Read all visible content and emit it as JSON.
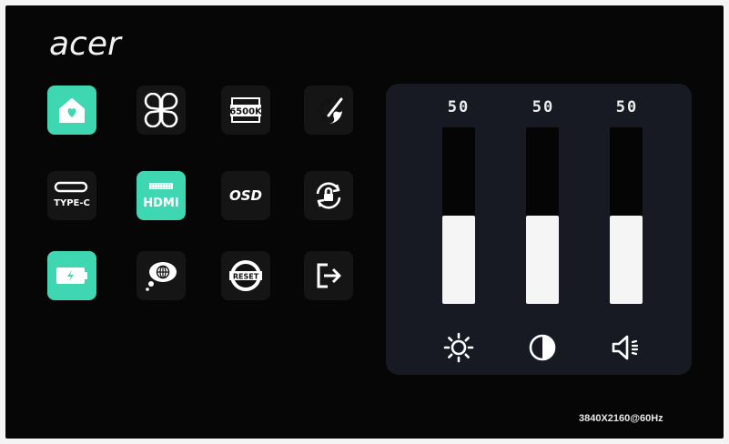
{
  "brand": {
    "logo_text": "acer"
  },
  "menu": {
    "items": [
      {
        "icon": "home-icon",
        "active": true
      },
      {
        "icon": "mode-grid-icon",
        "active": false
      },
      {
        "icon": "color-temperature-icon",
        "label": "6500K",
        "active": false
      },
      {
        "icon": "color-palette-icon",
        "active": false
      },
      {
        "icon": "type-c-icon",
        "label": "TYPE-C",
        "active": false
      },
      {
        "icon": "hdmi-icon",
        "label": "HDMI",
        "active": true
      },
      {
        "icon": "osd-icon",
        "label": "OSD",
        "active": false
      },
      {
        "icon": "lock-rotate-icon",
        "active": false
      },
      {
        "icon": "battery-charge-icon",
        "active": true
      },
      {
        "icon": "language-icon",
        "active": false
      },
      {
        "icon": "reset-icon",
        "label": "RESET",
        "active": false
      },
      {
        "icon": "exit-icon",
        "active": false
      }
    ]
  },
  "sliders": [
    {
      "name": "brightness",
      "value": "50",
      "level": 0.5,
      "icon": "brightness-icon"
    },
    {
      "name": "contrast",
      "value": "50",
      "level": 0.5,
      "icon": "contrast-icon"
    },
    {
      "name": "volume",
      "value": "50",
      "level": 0.5,
      "icon": "volume-icon"
    }
  ],
  "status": {
    "resolution": "3840X2160@60Hz"
  },
  "colors": {
    "accent": "#3fd6b2",
    "panel": "#171a22",
    "background": "#060606"
  }
}
